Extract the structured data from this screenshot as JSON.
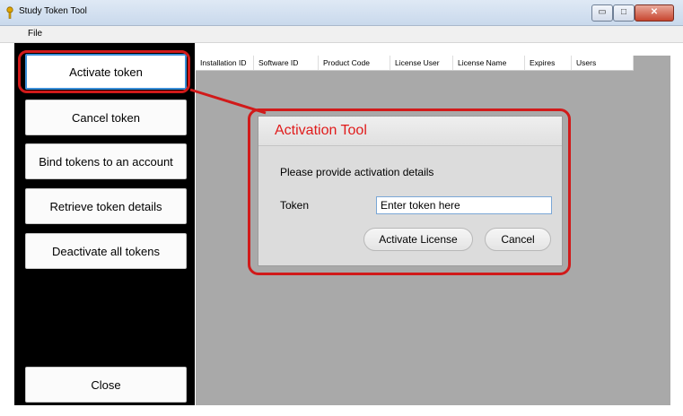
{
  "window": {
    "title": "Study Token Tool",
    "minimize_glyph": "▭",
    "maximize_glyph": "□",
    "close_glyph": "✕"
  },
  "menu": {
    "file_label": "File"
  },
  "sidebar": {
    "items": [
      {
        "label": "Activate token"
      },
      {
        "label": "Cancel token"
      },
      {
        "label": "Bind tokens to an account"
      },
      {
        "label": "Retrieve token details"
      },
      {
        "label": "Deactivate all tokens"
      }
    ],
    "close_label": "Close"
  },
  "grid": {
    "columns": [
      "Installation ID",
      "Software ID",
      "Product Code",
      "License User",
      "License Name",
      "Expires",
      "Users"
    ]
  },
  "dialog": {
    "title": "Activation Tool",
    "prompt": "Please provide activation details",
    "token_label": "Token",
    "token_value": "Enter token here",
    "activate_label": "Activate License",
    "cancel_label": "Cancel"
  },
  "colors": {
    "highlight": "#d11a1a",
    "dialog_title": "#e01b1b",
    "sidebar_bg": "#000000",
    "content_bg": "#a9a9a9"
  }
}
